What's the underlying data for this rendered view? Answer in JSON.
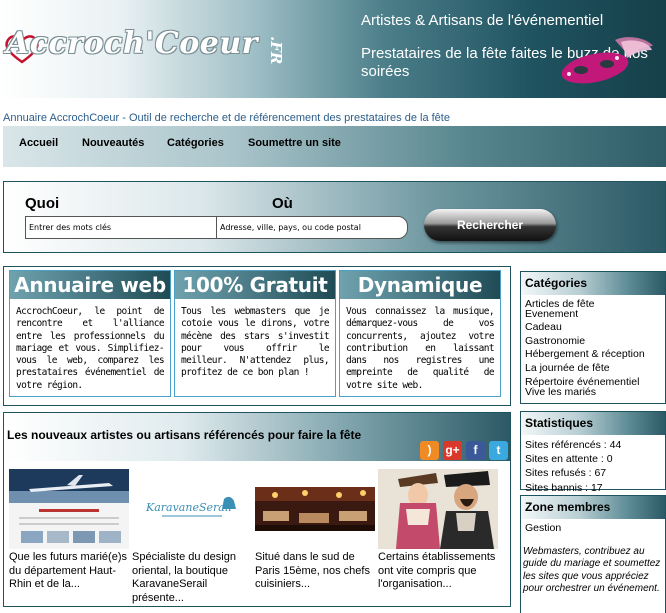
{
  "header": {
    "logo_text": "Accroch'Coeur",
    "logo_suffix": ".FR",
    "tagline1": "Artistes & Artisans de l'événementiel",
    "tagline2": "Prestataires de la fête faites le buzz de nos soirées"
  },
  "subtitle": "Annuaire AccrochCoeur - Outil de recherche et de référencement des prestataires de la fête",
  "nav": [
    "Accueil",
    "Nouveautés",
    "Catégories",
    "Soumettre un site"
  ],
  "search": {
    "what_label": "Quoi",
    "where_label": "Où",
    "what_placeholder": "Entrer des mots clés",
    "where_placeholder": "Adresse, ville, pays, ou code postal",
    "button_label": "Rechercher"
  },
  "features": [
    {
      "title": "Annuaire web",
      "text": "AccrochCoeur, le point de rencontre et l'alliance entre les professionnels du mariage et vous. Simplifiez-vous le web, comparez les prestataires événementiel de votre région."
    },
    {
      "title": "100% Gratuit",
      "text": "Tous les webmasters que je cotoie vous le dirons, votre mécène des stars s'investit pour vous offrir le meilleur. N'attendez plus, profitez de ce bon plan !"
    },
    {
      "title": "Dynamique",
      "text": "Vous connaissez la musique, démarquez-vous de vos concurrents, ajoutez votre contribution en laissant dans nos registres une empreinte de qualité de votre site web."
    }
  ],
  "newsites": {
    "title": "Les nouveaux artistes ou artisans référencés pour faire la fête",
    "thumb2_brand": "KaravaneSerail",
    "items": [
      {
        "caption": "Que les futurs marié(e)s du département Haut-Rhin et de la..."
      },
      {
        "caption": "Spécialiste du design oriental, la boutique KaravaneSerail présente..."
      },
      {
        "caption": "Situé dans le sud de Paris 15ème, nos chefs cuisiniers..."
      },
      {
        "caption": "Certains établissements ont vite compris que l'organisation..."
      }
    ]
  },
  "social": {
    "rss": ")",
    "google": "g+",
    "facebook": "f",
    "twitter": "t"
  },
  "sidebar": {
    "categories_title": "Catégories",
    "categories": [
      "Articles de fête",
      "Evenement",
      "Cadeau",
      "Gastronomie",
      "Hébergement & réception",
      "La journée de fête",
      "Répertoire événementiel",
      "Vive les mariés"
    ],
    "stats_title": "Statistiques",
    "stats": [
      "Sites référencés : 44",
      "Sites en attente : 0",
      "Sites refusés : 67",
      "Sites bannis : 17"
    ],
    "members_title": "Zone membres",
    "members_link": "Gestion",
    "members_note": "Webmasters, contribuez au guide du mariage et soumettez les sites que vous appréciez pour orchestrer un événement."
  },
  "colors": {
    "primary": "#1f5360",
    "link": "#2c5d8a",
    "feature_border": "#4aa0c8"
  }
}
